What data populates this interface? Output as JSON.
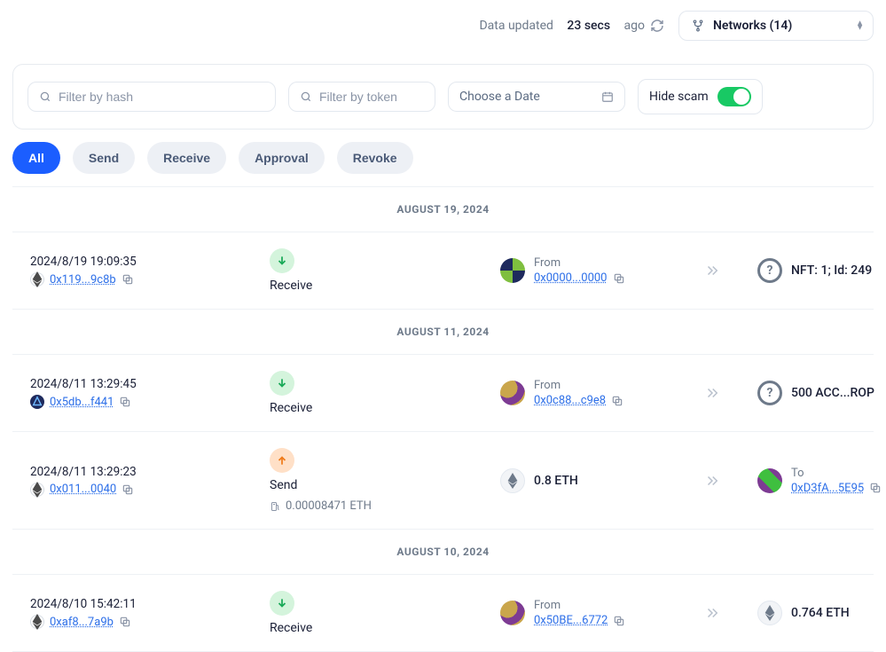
{
  "header": {
    "updated_prefix": "Data updated",
    "updated_value": "23 secs",
    "updated_suffix": "ago",
    "networks_label": "Networks (14)"
  },
  "filters": {
    "hash_placeholder": "Filter by hash",
    "token_placeholder": "Filter by token",
    "date_label": "Choose a Date",
    "hide_scam_label": "Hide scam",
    "hide_scam_on": true
  },
  "tabs": {
    "all": "All",
    "send": "Send",
    "receive": "Receive",
    "approval": "Approval",
    "revoke": "Revoke",
    "active": "all"
  },
  "groups": [
    {
      "date_label": "AUGUST 19, 2024",
      "rows": [
        {
          "timestamp": "2024/8/19 19:09:35",
          "chain": "eth",
          "hash": "0x119...9c8b",
          "type": "Receive",
          "type_kind": "recv",
          "party_dir": "From",
          "party_addr": "0x0000...0000",
          "avatar": "av1",
          "amount_kind": "unknown",
          "amount_text": "NFT: 1; Id: 249",
          "gas": null
        }
      ]
    },
    {
      "date_label": "AUGUST 11, 2024",
      "rows": [
        {
          "timestamp": "2024/8/11 13:29:45",
          "chain": "arb",
          "hash": "0x5db...f441",
          "type": "Receive",
          "type_kind": "recv",
          "party_dir": "From",
          "party_addr": "0x0c88...c9e8",
          "avatar": "av2",
          "amount_kind": "unknown",
          "amount_text": "500 ACC...ROP",
          "gas": null
        },
        {
          "timestamp": "2024/8/11 13:29:23",
          "chain": "eth",
          "hash": "0x011...0040",
          "type": "Send",
          "type_kind": "send",
          "party_dir": "To",
          "party_addr": "0xD3fA...5E95",
          "avatar": "av3",
          "amount_kind": "eth",
          "amount_text": "0.8 ETH",
          "gas": "0.00008471 ETH",
          "party_side": "right"
        }
      ]
    },
    {
      "date_label": "AUGUST 10, 2024",
      "rows": [
        {
          "timestamp": "2024/8/10 15:42:11",
          "chain": "eth",
          "hash": "0xaf8...7a9b",
          "type": "Receive",
          "type_kind": "recv",
          "party_dir": "From",
          "party_addr": "0x50BE...6772",
          "avatar": "av2",
          "amount_kind": "eth",
          "amount_text": "0.764 ETH",
          "gas": null
        }
      ]
    }
  ]
}
